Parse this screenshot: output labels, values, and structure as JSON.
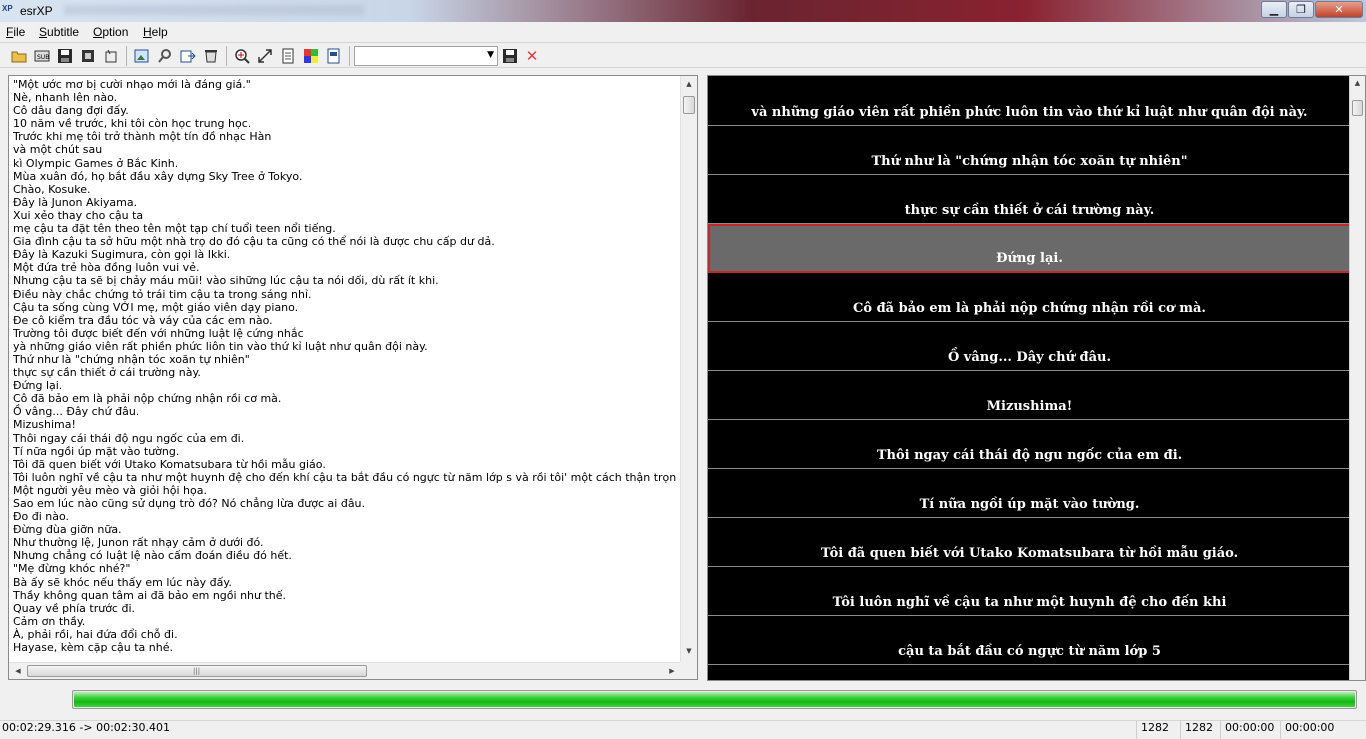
{
  "window": {
    "title": "esrXP",
    "icon_label": "XP"
  },
  "menu": [
    "File",
    "Subtitle",
    "Option",
    "Help"
  ],
  "toolbar": {
    "icons": [
      "open-folder-icon",
      "export-sub-icon",
      "save-icon",
      "film-icon",
      "tools-icon",
      "image-icon",
      "search-text-icon",
      "export-icon",
      "trash-icon",
      "zoom-icon",
      "resize-icon",
      "document-icon",
      "color-palette-icon",
      "text-file-icon"
    ],
    "combo_value": "",
    "delete_symbol": "✕"
  },
  "text_lines": [
    "\"Một ước mơ bị cười nhạo mới là đáng giá.\"",
    "Nè, nhanh lên nào.",
    "Cô dâu đang đợi đấy.",
    "10 năm về trước, khi tôi còn học trung học.",
    "Trước khi mẹ tôi trở thành một tín đồ nhạc Hàn",
    "và một chút sau",
    "kì Olympic Games ở Bắc Kinh.",
    "Mùa xuân đó, họ bắt đầu xây dựng Sky Tree ở Tokyo.",
    "Chào, Kosuke.",
    "Đây là Junon Akiyama.",
    "Xui xẻo thay cho cậu ta",
    "mẹ cậu ta đặt tên theo tên một tạp chí tuổi teen nổi tiếng.",
    "Gia đình cậu ta sở hữu một nhà trọ do đó cậu ta cũng có thể nói là được chu cấp dư dả.",
    "Đây là Kazuki Sugimura, còn gọi là Ikki.",
    "Một đứa trẻ hòa đồng luôn vui vẻ.",
    "Nhưng cậu ta sẽ bị chảy máu mũi! vào sihững lúc cậu ta nói dối, dù rất ít khi.",
    "Điều này chắc chứng tỏ trái tim cậu ta trong sáng nhỉ.",
    "Cậu ta sống cùng VỚI mẹ, một giáo viên dạy piano.",
    "Đe cô kiểm tra đầu tóc và váy của các em nào.",
    "Trường tôi được biết đến với những luật lệ cứng nhắc",
    " yà những giáo viên rất phiền phức liôn tin vào thứ kỉ luật như quân đội này.",
    "Thứ như là \"chứng nhận tóc xoăn tự nhiên\"",
    "thực sự cần thiết ở cái trường này.",
    "Đứng lại.",
    "Cô đã bảo em là phải nộp chứng nhận rồi cơ mà.",
    "Ồ vâng... Đây chứ đâu.",
    "Mizushima!",
    "Thôi ngay cái thái độ ngu ngốc của em đi.",
    "Tí nữa ngồi úp mặt vào tường.",
    "Tôi đã quen biết với Utako Komatsubara từ hồi mẫu giáo.",
    "Tôi luôn nghĩ về cậu ta như một huynh đệ cho đến khí cậu ta bắt đầu có ngực từ năm lớp s và rồi tôi' một cách thận trọng) nhận ra rằng cậ",
    "Một người yêu mèo và giỏi hội họa.",
    "Sao em lúc nào cũng sử dụng trò đó? Nó chẳng lừa được ai đâu.",
    "Đo đi nào.",
    "Đừng đùa giỡn nữa.",
    "Như thường lệ, Junon rất nhạy cảm ở dưới đó.",
    "Nhưng chẳng có luật lệ nào cấm đoán điều đó hết.",
    "\"Mẹ đừng khóc nhé?\"",
    "Bà ấy sẽ khóc nếu thấy em lúc này đấy.",
    "Thầy không quan tâm ai đã bảo em ngồi như thế.",
    "Quay về phía trước đi.",
    "Cảm ơn thầy.",
    "À, phải rồi, hai đứa đổi chỗ đi.",
    "Hayase, kèm cặp cậu ta nhé."
  ],
  "subtitles": [
    "và những giáo viên rất phiền phức luôn tin vào thứ kỉ luật như quân đội này.",
    "Thứ như là \"chứng nhận tóc xoăn tự nhiên\"",
    "thực sự cần thiết ở cái trường này.",
    "Đứng lại.",
    "Cô đã bảo em là phải nộp chứng nhận rồi cơ mà.",
    "Ồ vâng... Dây chứ đâu.",
    "Mizushima!",
    "Thôi ngay cái thái độ ngu ngốc của em đi.",
    "Tí nữa ngồi úp mặt vào tường.",
    "Tôi đã quen biết với Utako Komatsubara từ hồi mẫu giáo.",
    "Tôi luôn nghĩ về cậu ta như một huynh đệ cho đến khi",
    "cậu ta bắt đầu có ngực từ năm lớp 5"
  ],
  "selected_subtitle_index": 3,
  "progress": {
    "fraction": 1.0,
    "color": "#11b811"
  },
  "status": {
    "time_range": "00:02:29.316 -> 00:02:30.401",
    "count_a": "1282",
    "count_b": "1282",
    "time_a": "00:00:00",
    "time_b": "00:00:00"
  },
  "colors": {
    "selected_border": "#c0282a",
    "selected_bg": "#6a6a6a",
    "preview_bg": "#000000"
  }
}
